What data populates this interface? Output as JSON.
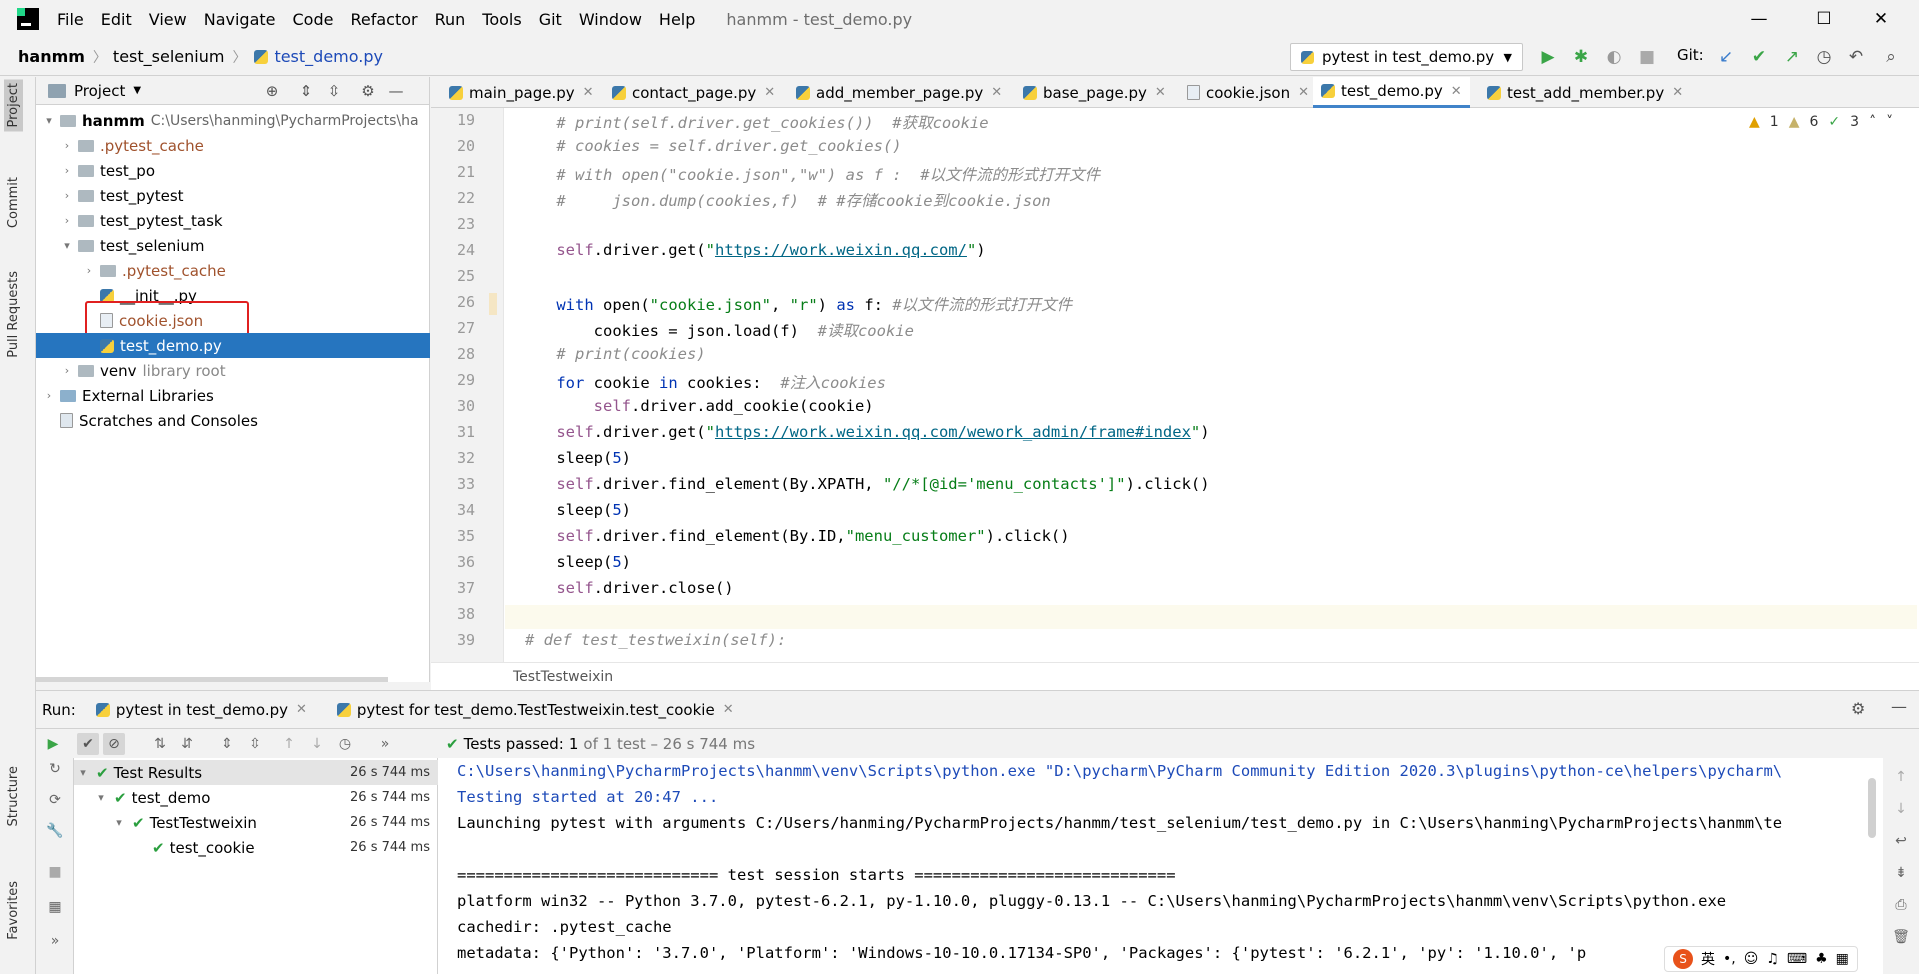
{
  "menu": [
    "File",
    "Edit",
    "View",
    "Navigate",
    "Code",
    "Refactor",
    "Run",
    "Tools",
    "Git",
    "Window",
    "Help"
  ],
  "window_title": "hanmm - test_demo.py",
  "window_controls": {
    "minimize": "—",
    "maximize": "☐",
    "close": "✕"
  },
  "breadcrumbs": [
    "hanmm",
    "test_selenium",
    "test_demo.py"
  ],
  "run_config": "pytest in test_demo.py",
  "git_label": "Git:",
  "project_panel": {
    "title": "Project",
    "tree": [
      {
        "label": "hanmm",
        "extra": "C:\\Users\\hanming\\PycharmProjects\\ha",
        "icon": "folder",
        "expanded": true,
        "depth": 0
      },
      {
        "label": ".pytest_cache",
        "icon": "folder",
        "expanded": false,
        "depth": 1,
        "color": "#a0522d"
      },
      {
        "label": "test_po",
        "icon": "folder",
        "expanded": false,
        "depth": 1
      },
      {
        "label": "test_pytest",
        "icon": "folder",
        "expanded": false,
        "depth": 1
      },
      {
        "label": "test_pytest_task",
        "icon": "folder",
        "expanded": false,
        "depth": 1
      },
      {
        "label": "test_selenium",
        "icon": "folder",
        "expanded": true,
        "depth": 1
      },
      {
        "label": ".pytest_cache",
        "icon": "folder",
        "expanded": false,
        "depth": 2,
        "color": "#a0522d"
      },
      {
        "label": "__init__.py",
        "icon": "python",
        "depth": 2
      },
      {
        "label": "cookie.json",
        "icon": "json",
        "depth": 2,
        "color": "#a0522d",
        "highlighted": true
      },
      {
        "label": "test_demo.py",
        "icon": "python",
        "depth": 2,
        "selected": true
      },
      {
        "label": "venv",
        "extra": "library root",
        "icon": "folder",
        "expanded": false,
        "depth": 1
      },
      {
        "label": "External Libraries",
        "icon": "library",
        "expanded": false,
        "depth": 0
      },
      {
        "label": "Scratches and Consoles",
        "icon": "scratch",
        "depth": 0
      }
    ]
  },
  "left_stripe": [
    "Project",
    "Commit",
    "Pull Requests",
    "Structure",
    "Favorites"
  ],
  "editor_tabs": [
    {
      "label": "main_page.py",
      "active": false
    },
    {
      "label": "contact_page.py",
      "active": false
    },
    {
      "label": "add_member_page.py",
      "active": false
    },
    {
      "label": "base_page.py",
      "active": false
    },
    {
      "label": "cookie.json",
      "active": false
    },
    {
      "label": "test_demo.py",
      "active": true
    },
    {
      "label": "test_add_member.py",
      "active": false
    }
  ],
  "inspections": {
    "warnings": "1",
    "weak_warnings": "6",
    "typos": "3"
  },
  "code_lines": [
    19,
    20,
    21,
    22,
    23,
    24,
    25,
    26,
    27,
    28,
    29,
    30,
    31,
    32,
    33,
    34,
    35,
    36,
    37,
    38,
    39
  ],
  "code_breadcrumb": "TestTestweixin",
  "run_panel": {
    "label": "Run:",
    "tabs": [
      "pytest in test_demo.py",
      "pytest for test_demo.TestTestweixin.test_cookie"
    ],
    "status_prefix": "Tests passed:",
    "status_count": "1",
    "status_rest": "of 1 test – 26 s 744 ms",
    "results": [
      {
        "label": "Test Results",
        "time": "26 s 744 ms",
        "depth": 0
      },
      {
        "label": "test_demo",
        "time": "26 s 744 ms",
        "depth": 1
      },
      {
        "label": "TestTestweixin",
        "time": "26 s 744 ms",
        "depth": 2
      },
      {
        "label": "test_cookie",
        "time": "26 s 744 ms",
        "depth": 3
      }
    ],
    "console": [
      "C:\\Users\\hanming\\PycharmProjects\\hanmm\\venv\\Scripts\\python.exe \"D:\\pycharm\\PyCharm Community Edition 2020.3\\plugins\\python-ce\\helpers\\pycharm\\",
      "Testing started at 20:47 ...",
      "Launching pytest with arguments C:/Users/hanming/PycharmProjects/hanmm/test_selenium/test_demo.py in C:\\Users\\hanming\\PycharmProjects\\hanmm\\te",
      "",
      "============================ test session starts ============================",
      "platform win32 -- Python 3.7.0, pytest-6.2.1, py-1.10.0, pluggy-0.13.1 -- C:\\Users\\hanming\\PycharmProjects\\hanmm\\venv\\Scripts\\python.exe",
      "cachedir: .pytest_cache",
      "metadata: {'Python': '3.7.0', 'Platform': 'Windows-10-10.0.17134-SP0', 'Packages': {'pytest': '6.2.1', 'py': '1.10.0', 'p"
    ]
  },
  "ime_label": "英"
}
